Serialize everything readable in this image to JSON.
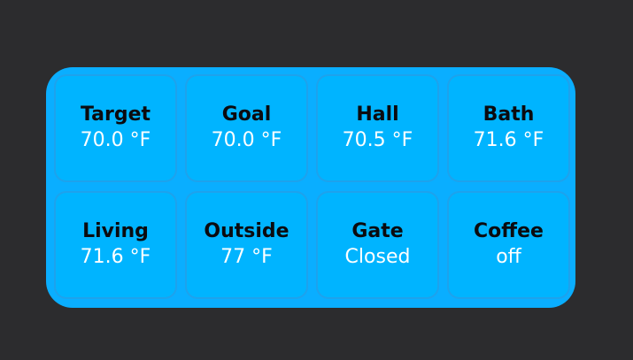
{
  "tiles": [
    {
      "name": "Target",
      "value": "70.0 °F"
    },
    {
      "name": "Goal",
      "value": "70.0 °F"
    },
    {
      "name": "Hall",
      "value": "70.5 °F"
    },
    {
      "name": "Bath",
      "value": "71.6 °F"
    },
    {
      "name": "Living",
      "value": "71.6 °F"
    },
    {
      "name": "Outside",
      "value": "77 °F"
    },
    {
      "name": "Gate",
      "value": "Closed"
    },
    {
      "name": "Coffee",
      "value": "off"
    }
  ],
  "colors": {
    "background": "#2c2c2e",
    "widget": "#0aaeff",
    "tile": "#00b4ff",
    "tile_border": "#1ea2ec",
    "name_text": "#0b0b0f",
    "value_text": "#ffffff"
  }
}
